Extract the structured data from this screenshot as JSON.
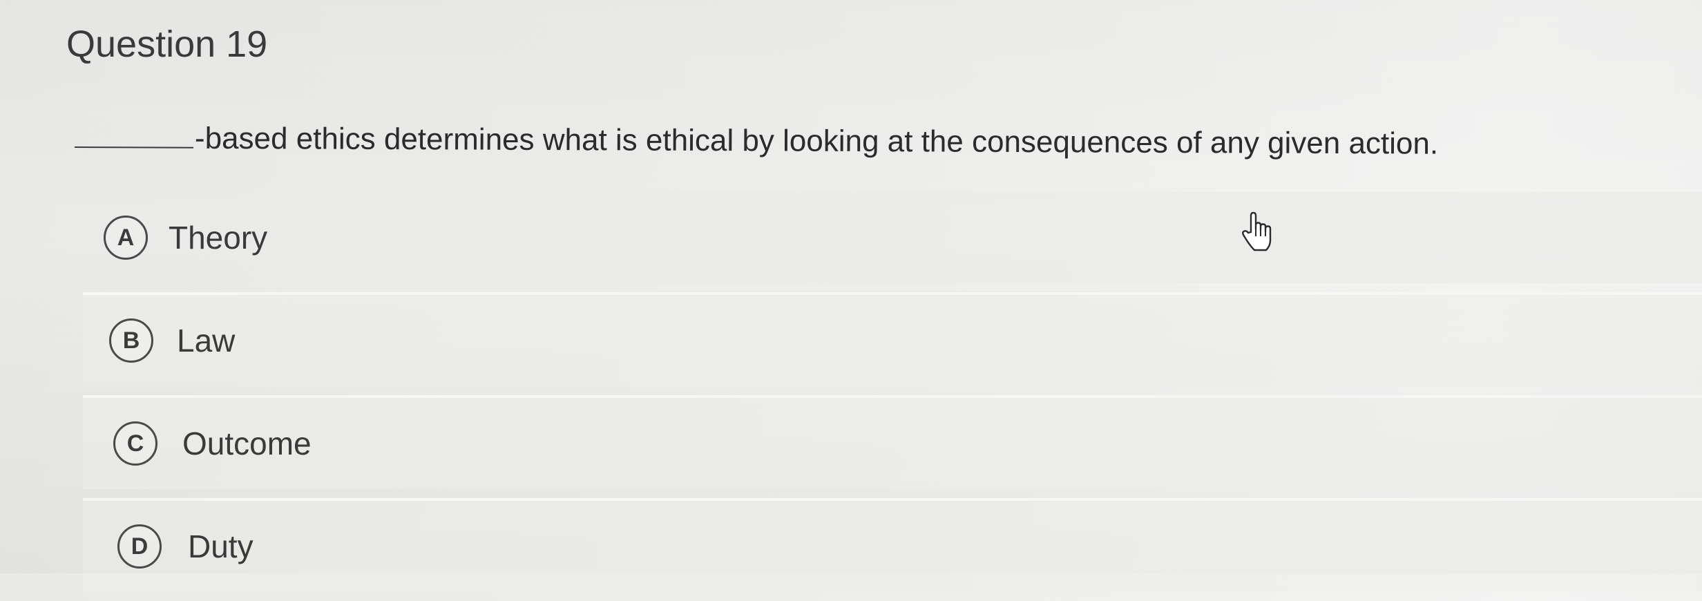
{
  "question": {
    "title": "Question 19",
    "prompt_text": "-based ethics determines what is ethical by looking at the consequences of any given action."
  },
  "options": [
    {
      "letter": "A",
      "label": "Theory"
    },
    {
      "letter": "B",
      "label": "Law"
    },
    {
      "letter": "C",
      "label": "Outcome"
    },
    {
      "letter": "D",
      "label": "Duty"
    }
  ],
  "cursor": {
    "icon": "hand-pointer-icon"
  }
}
